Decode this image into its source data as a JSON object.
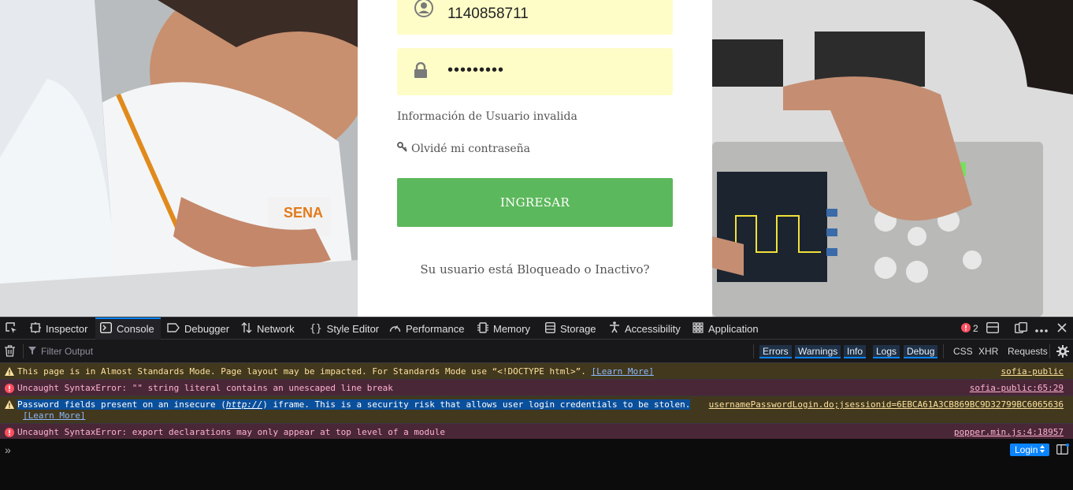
{
  "login": {
    "username_value": "1140858711",
    "password_value": "•••••••••",
    "error_message": "Información de Usuario invalida",
    "forgot_password": "Olvidé mi contraseña",
    "submit_label": "INGRESAR",
    "blocked_link": "Su usuario está Bloqueado o Inactivo?",
    "button_color": "#5cb85c",
    "field_color": "#fefdc8"
  },
  "devtools": {
    "tools": [
      {
        "label": "Inspector"
      },
      {
        "label": "Console"
      },
      {
        "label": "Debugger"
      },
      {
        "label": "Network"
      },
      {
        "label": "Style Editor"
      },
      {
        "label": "Performance"
      },
      {
        "label": "Memory"
      },
      {
        "label": "Storage"
      },
      {
        "label": "Accessibility"
      },
      {
        "label": "Application"
      }
    ],
    "active_tool": "Console",
    "error_count": "2",
    "filter_placeholder": "Filter Output",
    "filters": {
      "errors": "Errors",
      "warnings": "Warnings",
      "info": "Info",
      "logs": "Logs",
      "debug": "Debug",
      "css": "CSS",
      "xhr": "XHR",
      "requests": "Requests"
    },
    "messages": [
      {
        "level": "warning",
        "text": "This page is in Almost Standards Mode. Page layout may be impacted. For Standards Mode use “<!DOCTYPE html>”.",
        "learn_more": "[Learn More]",
        "source": "sofia-public"
      },
      {
        "level": "error",
        "text": "Uncaught SyntaxError: \"\" string literal contains an unescaped line break",
        "source": "sofia-public:65:29"
      },
      {
        "level": "warning",
        "text_a": "Password fields present on an insecure (",
        "text_http": "http://",
        "text_b": ") iframe. This is a security risk that allows user login credentials to be stolen.",
        "learn_more": "[Learn More]",
        "source": "usernamePasswordLogin.do;jsessionid=6EBCA61A3CB869BC9D32799BC6065636"
      },
      {
        "level": "error",
        "text": "Uncaught SyntaxError: export declarations may only appear at top level of a module",
        "source": "popper.min.js:4:18957"
      }
    ],
    "input_prompt": "»",
    "context_selector": "Login",
    "colors": {
      "accent": "#0a84ff",
      "warning_bg": "#42381d",
      "error_bg": "#4a2737",
      "error_badge": "#ff4f5e"
    }
  }
}
